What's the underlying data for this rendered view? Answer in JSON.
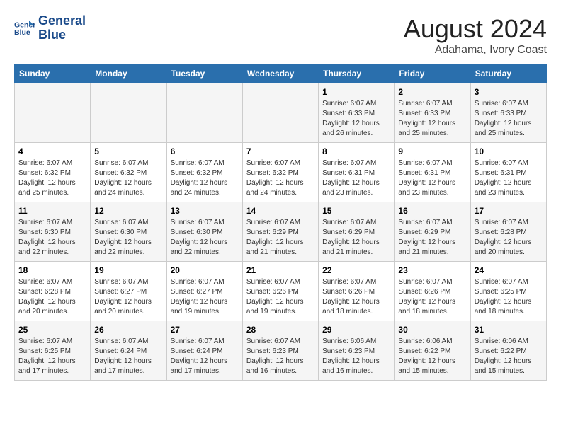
{
  "logo": {
    "line1": "General",
    "line2": "Blue"
  },
  "title": "August 2024",
  "subtitle": "Adahama, Ivory Coast",
  "days_of_week": [
    "Sunday",
    "Monday",
    "Tuesday",
    "Wednesday",
    "Thursday",
    "Friday",
    "Saturday"
  ],
  "weeks": [
    [
      {
        "day": "",
        "info": ""
      },
      {
        "day": "",
        "info": ""
      },
      {
        "day": "",
        "info": ""
      },
      {
        "day": "",
        "info": ""
      },
      {
        "day": "1",
        "info": "Sunrise: 6:07 AM\nSunset: 6:33 PM\nDaylight: 12 hours\nand 26 minutes."
      },
      {
        "day": "2",
        "info": "Sunrise: 6:07 AM\nSunset: 6:33 PM\nDaylight: 12 hours\nand 25 minutes."
      },
      {
        "day": "3",
        "info": "Sunrise: 6:07 AM\nSunset: 6:33 PM\nDaylight: 12 hours\nand 25 minutes."
      }
    ],
    [
      {
        "day": "4",
        "info": "Sunrise: 6:07 AM\nSunset: 6:32 PM\nDaylight: 12 hours\nand 25 minutes."
      },
      {
        "day": "5",
        "info": "Sunrise: 6:07 AM\nSunset: 6:32 PM\nDaylight: 12 hours\nand 24 minutes."
      },
      {
        "day": "6",
        "info": "Sunrise: 6:07 AM\nSunset: 6:32 PM\nDaylight: 12 hours\nand 24 minutes."
      },
      {
        "day": "7",
        "info": "Sunrise: 6:07 AM\nSunset: 6:32 PM\nDaylight: 12 hours\nand 24 minutes."
      },
      {
        "day": "8",
        "info": "Sunrise: 6:07 AM\nSunset: 6:31 PM\nDaylight: 12 hours\nand 23 minutes."
      },
      {
        "day": "9",
        "info": "Sunrise: 6:07 AM\nSunset: 6:31 PM\nDaylight: 12 hours\nand 23 minutes."
      },
      {
        "day": "10",
        "info": "Sunrise: 6:07 AM\nSunset: 6:31 PM\nDaylight: 12 hours\nand 23 minutes."
      }
    ],
    [
      {
        "day": "11",
        "info": "Sunrise: 6:07 AM\nSunset: 6:30 PM\nDaylight: 12 hours\nand 22 minutes."
      },
      {
        "day": "12",
        "info": "Sunrise: 6:07 AM\nSunset: 6:30 PM\nDaylight: 12 hours\nand 22 minutes."
      },
      {
        "day": "13",
        "info": "Sunrise: 6:07 AM\nSunset: 6:30 PM\nDaylight: 12 hours\nand 22 minutes."
      },
      {
        "day": "14",
        "info": "Sunrise: 6:07 AM\nSunset: 6:29 PM\nDaylight: 12 hours\nand 21 minutes."
      },
      {
        "day": "15",
        "info": "Sunrise: 6:07 AM\nSunset: 6:29 PM\nDaylight: 12 hours\nand 21 minutes."
      },
      {
        "day": "16",
        "info": "Sunrise: 6:07 AM\nSunset: 6:29 PM\nDaylight: 12 hours\nand 21 minutes."
      },
      {
        "day": "17",
        "info": "Sunrise: 6:07 AM\nSunset: 6:28 PM\nDaylight: 12 hours\nand 20 minutes."
      }
    ],
    [
      {
        "day": "18",
        "info": "Sunrise: 6:07 AM\nSunset: 6:28 PM\nDaylight: 12 hours\nand 20 minutes."
      },
      {
        "day": "19",
        "info": "Sunrise: 6:07 AM\nSunset: 6:27 PM\nDaylight: 12 hours\nand 20 minutes."
      },
      {
        "day": "20",
        "info": "Sunrise: 6:07 AM\nSunset: 6:27 PM\nDaylight: 12 hours\nand 19 minutes."
      },
      {
        "day": "21",
        "info": "Sunrise: 6:07 AM\nSunset: 6:26 PM\nDaylight: 12 hours\nand 19 minutes."
      },
      {
        "day": "22",
        "info": "Sunrise: 6:07 AM\nSunset: 6:26 PM\nDaylight: 12 hours\nand 18 minutes."
      },
      {
        "day": "23",
        "info": "Sunrise: 6:07 AM\nSunset: 6:26 PM\nDaylight: 12 hours\nand 18 minutes."
      },
      {
        "day": "24",
        "info": "Sunrise: 6:07 AM\nSunset: 6:25 PM\nDaylight: 12 hours\nand 18 minutes."
      }
    ],
    [
      {
        "day": "25",
        "info": "Sunrise: 6:07 AM\nSunset: 6:25 PM\nDaylight: 12 hours\nand 17 minutes."
      },
      {
        "day": "26",
        "info": "Sunrise: 6:07 AM\nSunset: 6:24 PM\nDaylight: 12 hours\nand 17 minutes."
      },
      {
        "day": "27",
        "info": "Sunrise: 6:07 AM\nSunset: 6:24 PM\nDaylight: 12 hours\nand 17 minutes."
      },
      {
        "day": "28",
        "info": "Sunrise: 6:07 AM\nSunset: 6:23 PM\nDaylight: 12 hours\nand 16 minutes."
      },
      {
        "day": "29",
        "info": "Sunrise: 6:06 AM\nSunset: 6:23 PM\nDaylight: 12 hours\nand 16 minutes."
      },
      {
        "day": "30",
        "info": "Sunrise: 6:06 AM\nSunset: 6:22 PM\nDaylight: 12 hours\nand 15 minutes."
      },
      {
        "day": "31",
        "info": "Sunrise: 6:06 AM\nSunset: 6:22 PM\nDaylight: 12 hours\nand 15 minutes."
      }
    ]
  ]
}
